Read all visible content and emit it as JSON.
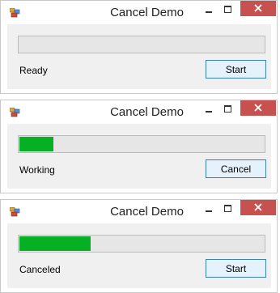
{
  "windows": [
    {
      "title": "Cancel Demo",
      "progress_fraction": 0,
      "status": "Ready",
      "button_label": "Start"
    },
    {
      "title": "Cancel Demo",
      "progress_fraction": 0.14,
      "status": "Working",
      "button_label": "Cancel"
    },
    {
      "title": "Cancel Demo",
      "progress_fraction": 0.29,
      "status": "Canceled",
      "button_label": "Start"
    }
  ],
  "colors": {
    "progress_fill": "#06b025",
    "close_button": "#c7514e"
  },
  "icons": {
    "app": "app-icon",
    "minimize": "minimize-icon",
    "maximize": "maximize-icon",
    "close": "close-icon"
  }
}
